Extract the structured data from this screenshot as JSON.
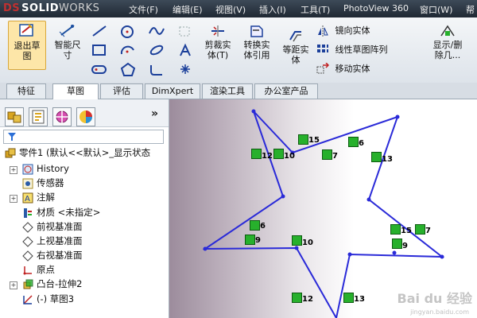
{
  "app": {
    "logo_ds": "DS",
    "logo_solid": "SOLID",
    "logo_works": "WORKS"
  },
  "menu": [
    "文件(F)",
    "编辑(E)",
    "视图(V)",
    "插入(I)",
    "工具(T)",
    "PhotoView 360",
    "窗口(W)",
    "帮"
  ],
  "ribbon": {
    "exit_sketch": [
      "退出草",
      "图"
    ],
    "smart_dim": [
      "智能尺",
      "寸"
    ],
    "trim": [
      "剪裁实",
      "体(T)"
    ],
    "convert": [
      "转换实",
      "体引用"
    ],
    "offset": [
      "等距实",
      "体"
    ],
    "mirror": "镜向实体",
    "linear_pattern": "线性草图阵列",
    "move": "移动实体",
    "display_delete": [
      "显示/删",
      "除几..."
    ]
  },
  "tabs": [
    "特征",
    "草图",
    "评估",
    "DimXpert",
    "渲染工具",
    "办公室产品"
  ],
  "active_tab": "草图",
  "tree": {
    "root": "零件1 (默认<<默认>_显示状态",
    "items": [
      "History",
      "传感器",
      "注解",
      "材质 <未指定>",
      "前视基准面",
      "上视基准面",
      "右视基准面",
      "原点",
      "凸台-拉伸2",
      "(-) 草图3"
    ]
  },
  "relations": [
    "15",
    "6",
    "12",
    "10",
    "7",
    "13",
    "6",
    "9",
    "10",
    "15",
    "7",
    "9",
    "12",
    "13"
  ],
  "watermark": {
    "main": "Bai du 经验",
    "sub": "jingyan.baidu.com"
  },
  "colors": {
    "sketch_line": "#2a2ad8",
    "relation_green": "#27b02c",
    "active_tab": "#ffffff"
  }
}
